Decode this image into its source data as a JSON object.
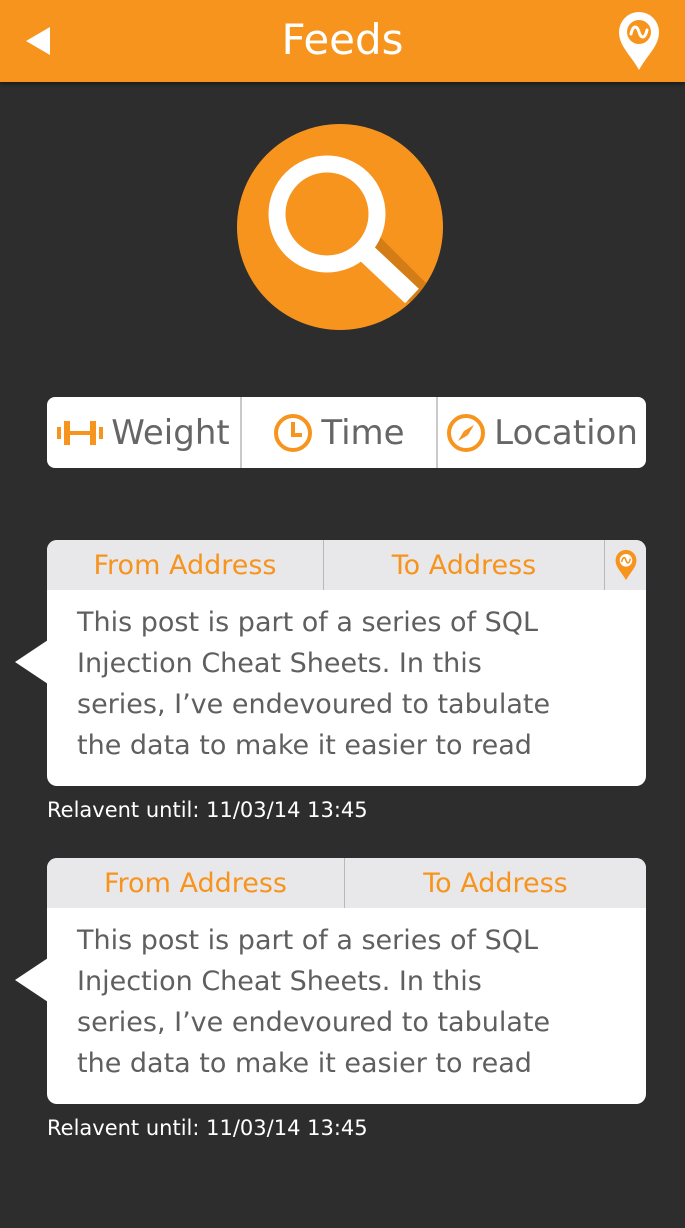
{
  "header": {
    "title": "Feeds",
    "back_icon": "back-arrow-icon",
    "location_icon": "location-pin-icon"
  },
  "search": {
    "icon": "search-icon"
  },
  "filters": [
    {
      "label": "Weight",
      "icon": "weight-icon"
    },
    {
      "label": "Time",
      "icon": "clock-icon"
    },
    {
      "label": "Location",
      "icon": "compass-icon"
    }
  ],
  "feeds": [
    {
      "from_label": "From Address",
      "to_label": "To Address",
      "has_pin": true,
      "body": "This post is part of a series of SQL\nInjection Cheat Sheets.  In this\nseries, I’ve endevoured to tabulate\nthe data to make it easier to read",
      "relevant": "Relavent until: 11/03/14 13:45"
    },
    {
      "from_label": "From Address",
      "to_label": "To Address",
      "has_pin": false,
      "body": "This post is part of a series of SQL\nInjection Cheat Sheets.  In this\nseries, I’ve endevoured to tabulate\nthe data to make it easier to read",
      "relevant": "Relavent until: 11/03/14 13:45"
    }
  ],
  "colors": {
    "accent": "#f7941e",
    "background": "#2d2d2d",
    "card": "#ffffff",
    "card_header": "#e8e8ea",
    "body_text": "#5f5f5f"
  }
}
